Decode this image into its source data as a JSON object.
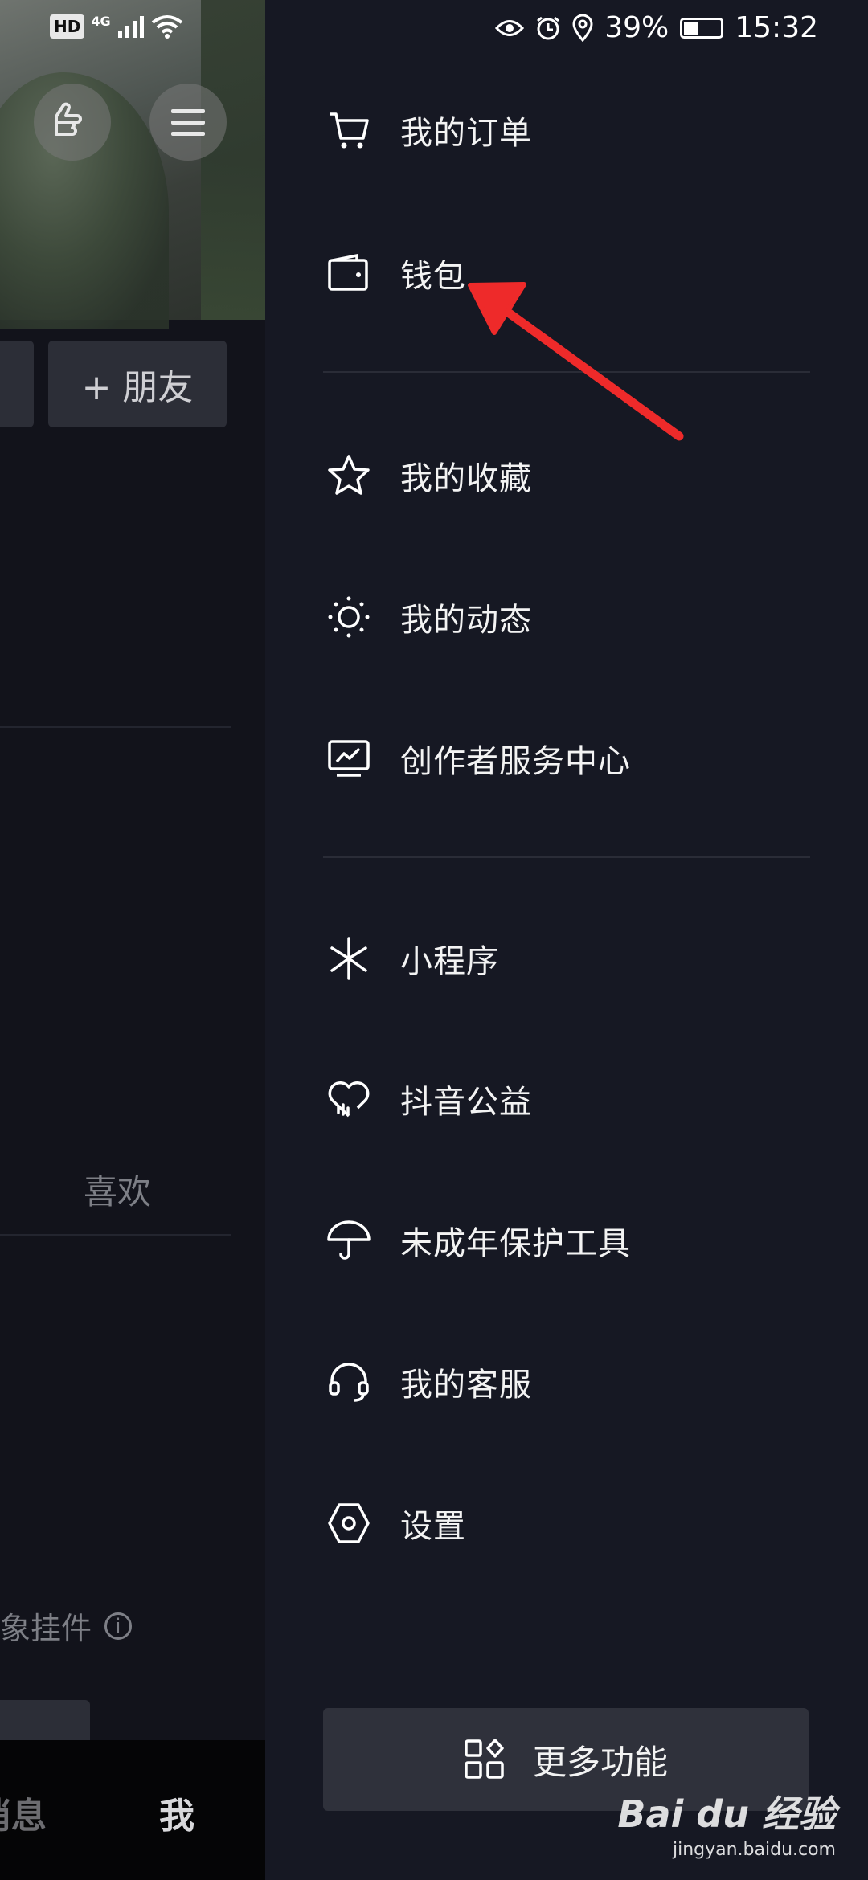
{
  "status_bar": {
    "network": "HD",
    "signal": "4G",
    "battery": "39%",
    "time": "15:32"
  },
  "left_panel": {
    "friend_button": "+ 朋友",
    "likes_tab": "喜欢",
    "widget_label": "象挂件",
    "tab_messages": "消息",
    "tab_me": "我"
  },
  "menu": {
    "items": [
      {
        "label": "我的订单",
        "icon": "cart-icon"
      },
      {
        "label": "钱包",
        "icon": "wallet-icon"
      },
      {
        "label": "我的收藏",
        "icon": "star-icon"
      },
      {
        "label": "我的动态",
        "icon": "sun-icon"
      },
      {
        "label": "创作者服务中心",
        "icon": "monitor-chart-icon"
      },
      {
        "label": "小程序",
        "icon": "mini-program-icon"
      },
      {
        "label": "抖音公益",
        "icon": "heart-icon"
      },
      {
        "label": "未成年保护工具",
        "icon": "umbrella-icon"
      },
      {
        "label": "我的客服",
        "icon": "headset-icon"
      },
      {
        "label": "设置",
        "icon": "hexagon-settings-icon"
      }
    ],
    "more_button": "更多功能"
  },
  "annotation": {
    "arrow_color": "#ee2a2a"
  },
  "watermark": {
    "line1": "Bai du 经验",
    "line2": "jingyan.baidu.com"
  }
}
